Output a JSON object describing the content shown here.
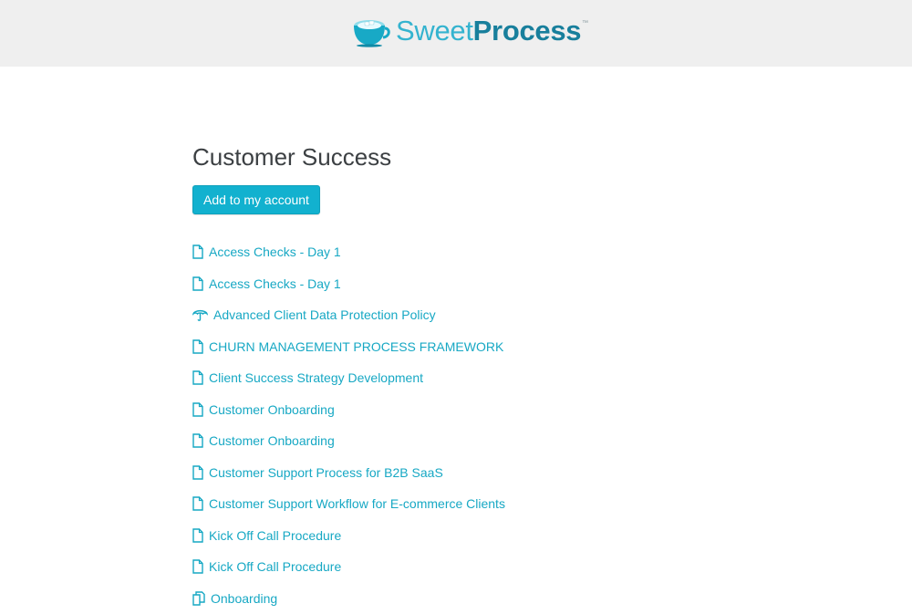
{
  "brand": {
    "name_light": "Sweet",
    "name_bold": "Process",
    "trademark": "™",
    "logo_icon": "coffee-cup-icon"
  },
  "page": {
    "title": "Customer Success",
    "add_button_label": "Add to my account"
  },
  "items": [
    {
      "label": "Access Checks - Day 1",
      "icon": "document-icon"
    },
    {
      "label": "Access Checks - Day 1",
      "icon": "document-icon"
    },
    {
      "label": "Advanced Client Data Protection Policy",
      "icon": "umbrella-icon"
    },
    {
      "label": "CHURN MANAGEMENT PROCESS FRAMEWORK",
      "icon": "document-icon"
    },
    {
      "label": "Client Success Strategy Development",
      "icon": "document-icon"
    },
    {
      "label": "Customer Onboarding",
      "icon": "document-icon"
    },
    {
      "label": "Customer Onboarding",
      "icon": "document-icon"
    },
    {
      "label": "Customer Support Process for B2B SaaS",
      "icon": "document-icon"
    },
    {
      "label": "Customer Support Workflow for E-commerce Clients",
      "icon": "document-icon"
    },
    {
      "label": "Kick Off Call Procedure",
      "icon": "document-icon"
    },
    {
      "label": "Kick Off Call Procedure",
      "icon": "document-icon"
    },
    {
      "label": "Onboarding",
      "icon": "copy-icon"
    }
  ],
  "colors": {
    "accent": "#12b1cf",
    "link": "#17a8c4",
    "header_bg": "#efefef",
    "title": "#3c4043"
  }
}
